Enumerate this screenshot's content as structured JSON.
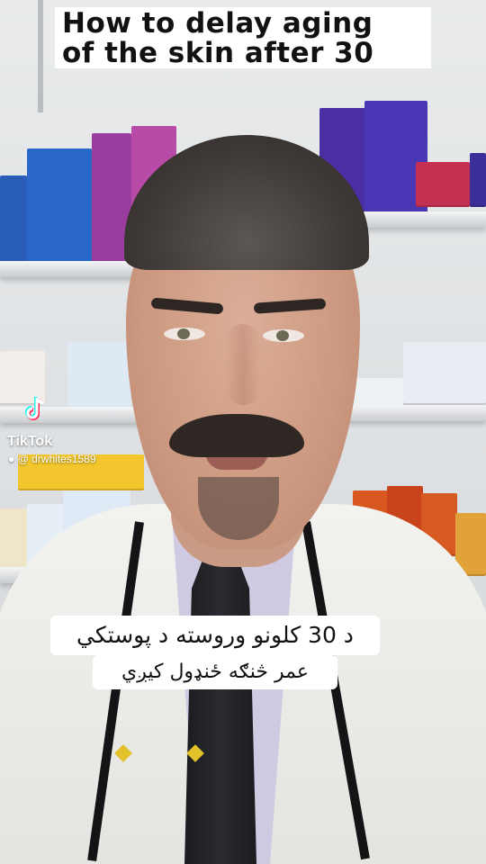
{
  "video": {
    "title_lines": [
      "How to delay aging",
      "of the skin after 30"
    ],
    "caption_lines": [
      "د 30 کلونو وروسته د پوستکي",
      "عمر څنګه ځنډول کیږي"
    ]
  },
  "watermark": {
    "brand": "TikTok",
    "user_icon": "user-icon",
    "username": "@ drwhites1589"
  },
  "colors": {
    "overlay_bg": "#ffffff",
    "overlay_text": "#111111",
    "tiktok_cyan": "#25f4ee",
    "tiktok_red": "#fe2c55"
  }
}
